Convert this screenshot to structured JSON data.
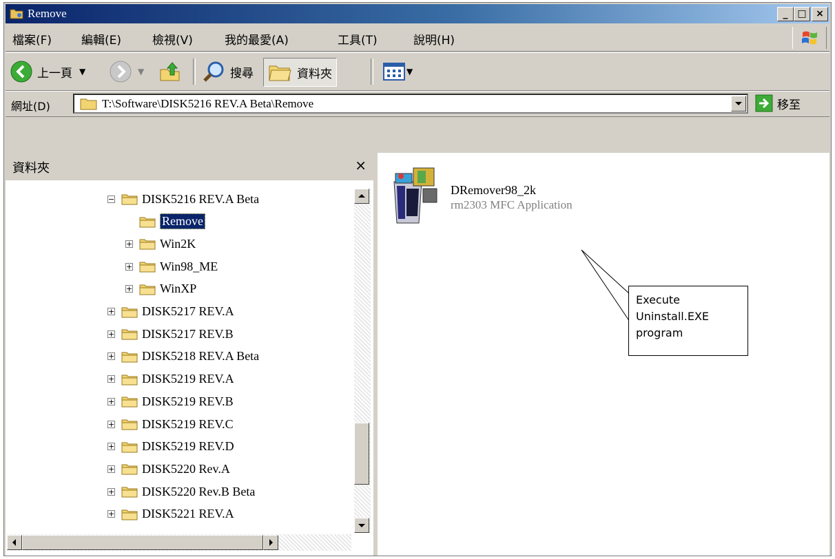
{
  "window": {
    "title": "Remove",
    "controls": {
      "minimize": "_",
      "maximize": "□",
      "close": "×"
    }
  },
  "menubar": {
    "items": [
      "檔案(F)",
      "編輯(E)",
      "檢視(V)",
      "我的最愛(A)",
      "工具(T)",
      "說明(H)"
    ]
  },
  "toolbar": {
    "back_label": "上一頁",
    "search_label": "搜尋",
    "folders_label": "資料夾"
  },
  "address": {
    "label": "網址(D)",
    "value": "T:\\Software\\DISK5216 REV.A Beta\\Remove",
    "go_label": "移至"
  },
  "folders_pane": {
    "title": "資料夾",
    "close": "×",
    "tree": [
      {
        "label": "DISK5216 REV.A Beta",
        "expander": "minus",
        "level": 0
      },
      {
        "label": "Remove",
        "expander": "none",
        "level": 1,
        "selected": true
      },
      {
        "label": "Win2K",
        "expander": "plus",
        "level": 1
      },
      {
        "label": "Win98_ME",
        "expander": "plus",
        "level": 1
      },
      {
        "label": "WinXP",
        "expander": "plus",
        "level": 1
      },
      {
        "label": "DISK5217 REV.A",
        "expander": "plus",
        "level": 0
      },
      {
        "label": "DISK5217 REV.B",
        "expander": "plus",
        "level": 0
      },
      {
        "label": "DISK5218 REV.A Beta",
        "expander": "plus",
        "level": 0
      },
      {
        "label": "DISK5219 REV.A",
        "expander": "plus",
        "level": 0
      },
      {
        "label": "DISK5219 REV.B",
        "expander": "plus",
        "level": 0
      },
      {
        "label": "DISK5219 REV.C",
        "expander": "plus",
        "level": 0
      },
      {
        "label": "DISK5219 REV.D",
        "expander": "plus",
        "level": 0
      },
      {
        "label": "DISK5220 Rev.A",
        "expander": "plus",
        "level": 0
      },
      {
        "label": "DISK5220 Rev.B Beta",
        "expander": "plus",
        "level": 0
      },
      {
        "label": "DISK5221 REV.A",
        "expander": "plus",
        "level": 0
      }
    ]
  },
  "file_view": {
    "items": [
      {
        "name": "DRemover98_2k",
        "description": "rm2303 MFC Application"
      }
    ]
  },
  "callout": {
    "lines": [
      "Execute",
      "Uninstall.EXE",
      "program"
    ]
  }
}
